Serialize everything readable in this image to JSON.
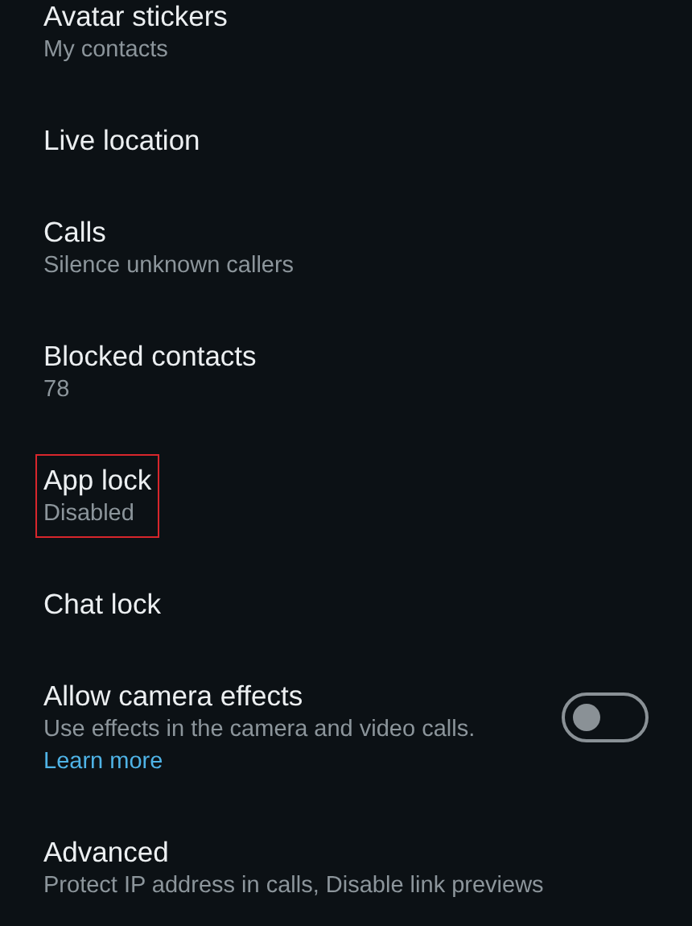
{
  "settings": [
    {
      "title": "Avatar stickers",
      "subtitle": "My contacts",
      "highlighted": false
    },
    {
      "title": "Live location",
      "highlighted": false
    },
    {
      "title": "Calls",
      "subtitle": "Silence unknown callers",
      "highlighted": false
    },
    {
      "title": "Blocked contacts",
      "subtitle": "78",
      "highlighted": false
    },
    {
      "title": "App lock",
      "subtitle": "Disabled",
      "highlighted": true
    },
    {
      "title": "Chat lock",
      "highlighted": false
    },
    {
      "title": "Allow camera effects",
      "subtitle": "Use effects in the camera and video calls.",
      "link": "Learn more",
      "toggle": {
        "on": false
      },
      "highlighted": false
    },
    {
      "title": "Advanced",
      "subtitle": "Protect IP address in calls, Disable link previews",
      "highlighted": false
    }
  ]
}
